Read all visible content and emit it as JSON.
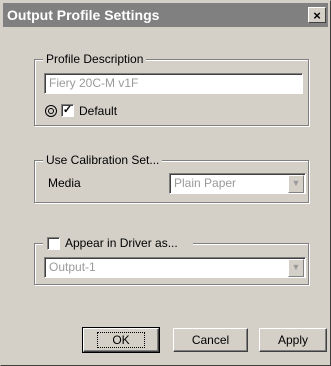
{
  "window": {
    "title": "Output Profile Settings",
    "close_glyph": "×"
  },
  "profile_description": {
    "legend": "Profile Description",
    "value": "Fiery 20C-M v1F",
    "default_label": "Default",
    "default_checked": true
  },
  "calibration": {
    "legend": "Use Calibration Set...",
    "media_label": "Media",
    "media_value": "Plain Paper"
  },
  "driver": {
    "legend": "Appear in Driver as...",
    "checked": false,
    "value": "Output-1"
  },
  "buttons": {
    "ok": "OK",
    "cancel": "Cancel",
    "apply": "Apply"
  },
  "icons": {
    "default_radio": "target-icon",
    "dropdown": "chevron-down-icon"
  }
}
